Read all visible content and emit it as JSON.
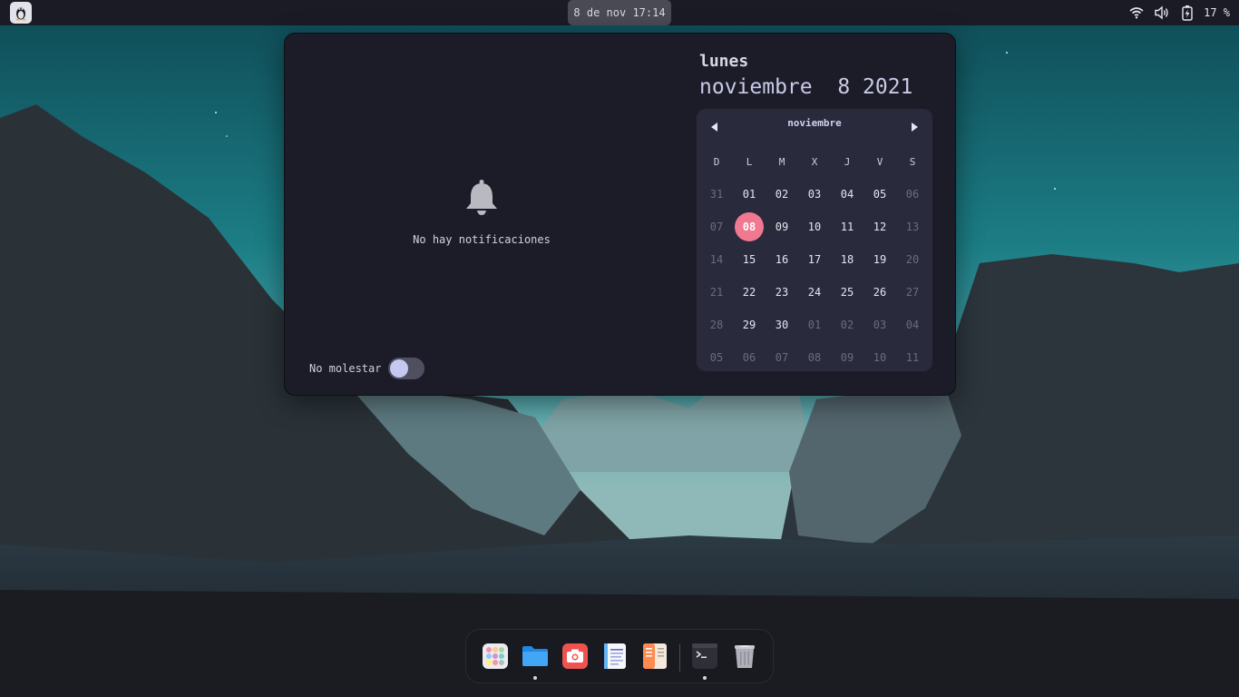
{
  "topbar": {
    "clock": "8 de nov 17:14",
    "battery_percent": "17 %",
    "icons": [
      "tux-logo-icon",
      "wifi-icon",
      "volume-icon",
      "battery-charging-icon"
    ]
  },
  "notifications": {
    "empty_icon": "bell-icon",
    "empty_text": "No hay notificaciones",
    "dnd_label": "No molestar",
    "dnd_enabled": false
  },
  "date_header": {
    "day_name": "lunes",
    "full_date": "noviembre  8 2021"
  },
  "calendar": {
    "month_label": "noviembre",
    "weekdays": [
      "D",
      "L",
      "M",
      "X",
      "J",
      "V",
      "S"
    ],
    "days": [
      {
        "label": "31",
        "other": true
      },
      {
        "label": "01"
      },
      {
        "label": "02"
      },
      {
        "label": "03"
      },
      {
        "label": "04"
      },
      {
        "label": "05"
      },
      {
        "label": "06",
        "other": true
      },
      {
        "label": "07",
        "other": true
      },
      {
        "label": "08",
        "today": true
      },
      {
        "label": "09"
      },
      {
        "label": "10"
      },
      {
        "label": "11"
      },
      {
        "label": "12"
      },
      {
        "label": "13",
        "other": true
      },
      {
        "label": "14",
        "other": true
      },
      {
        "label": "15"
      },
      {
        "label": "16"
      },
      {
        "label": "17"
      },
      {
        "label": "18"
      },
      {
        "label": "19"
      },
      {
        "label": "20",
        "other": true
      },
      {
        "label": "21",
        "other": true
      },
      {
        "label": "22"
      },
      {
        "label": "23"
      },
      {
        "label": "24"
      },
      {
        "label": "25"
      },
      {
        "label": "26"
      },
      {
        "label": "27",
        "other": true
      },
      {
        "label": "28",
        "other": true
      },
      {
        "label": "29"
      },
      {
        "label": "30"
      },
      {
        "label": "01",
        "other": true
      },
      {
        "label": "02",
        "other": true
      },
      {
        "label": "03",
        "other": true
      },
      {
        "label": "04",
        "other": true
      },
      {
        "label": "05",
        "other": true
      },
      {
        "label": "06",
        "other": true
      },
      {
        "label": "07",
        "other": true
      },
      {
        "label": "08",
        "other": true
      },
      {
        "label": "09",
        "other": true
      },
      {
        "label": "10",
        "other": true
      },
      {
        "label": "11",
        "other": true
      }
    ],
    "today_color": "#f07890"
  },
  "dock": {
    "items": [
      {
        "name": "app-launcher-icon",
        "running": false
      },
      {
        "name": "files-icon",
        "running": true
      },
      {
        "name": "screenshot-icon",
        "running": false
      },
      {
        "name": "text-editor-icon",
        "running": false
      },
      {
        "name": "document-viewer-icon",
        "running": false
      },
      {
        "name": "terminal-icon",
        "running": true
      },
      {
        "name": "trash-icon",
        "running": false
      }
    ]
  },
  "colors": {
    "panel_bg": "#1c1c29",
    "calendar_bg": "#2a2a3d",
    "accent": "#f07890",
    "toggle_knob": "#c6c8f2"
  }
}
